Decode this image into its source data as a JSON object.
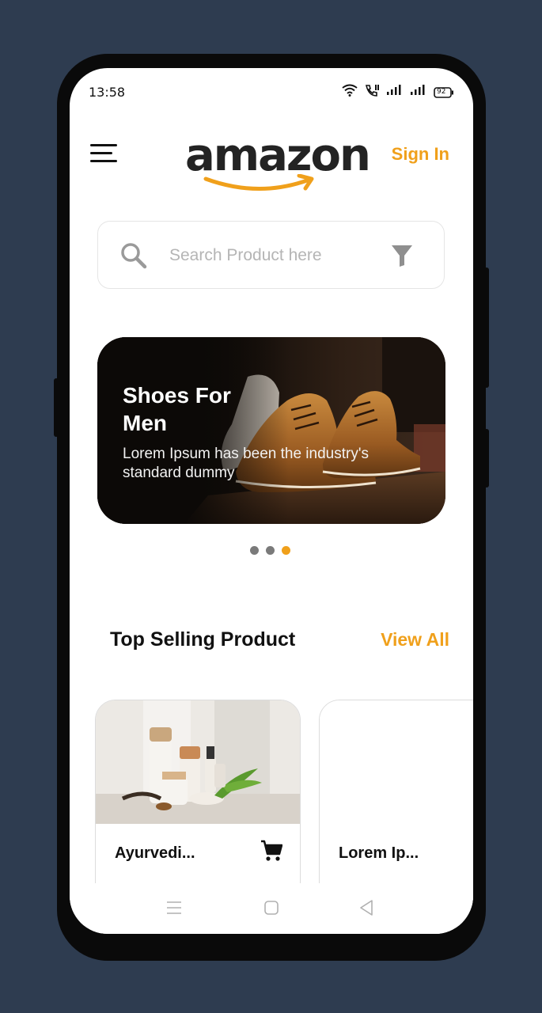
{
  "status_bar": {
    "time": "13:58",
    "battery": "92",
    "icons": [
      "wifi-icon",
      "call-icon",
      "signal-icon",
      "signal-icon",
      "battery-icon"
    ]
  },
  "header": {
    "logo_text": "amazon",
    "sign_in_label": "Sign In",
    "menu_icon": "hamburger-menu-icon"
  },
  "search": {
    "placeholder": "Search Product here",
    "value": "",
    "search_icon": "search-icon",
    "filter_icon": "filter-icon"
  },
  "banner": {
    "title": "Shoes For Men",
    "description": "Lorem Ipsum has been the industry's standard dummy",
    "slide_count": 3,
    "active_slide": 3
  },
  "section": {
    "title": "Top Selling Product",
    "view_all_label": "View All"
  },
  "products": [
    {
      "name": "Ayurvedi...",
      "cart_icon": "cart-icon"
    },
    {
      "name": "Lorem Ip..."
    }
  ],
  "nav_bar": {
    "icons": [
      "recent-apps-icon",
      "home-icon",
      "back-icon"
    ]
  },
  "colors": {
    "accent": "#f0a01b",
    "background": "#2e3c50",
    "dot_inactive": "#7a7a7a"
  }
}
